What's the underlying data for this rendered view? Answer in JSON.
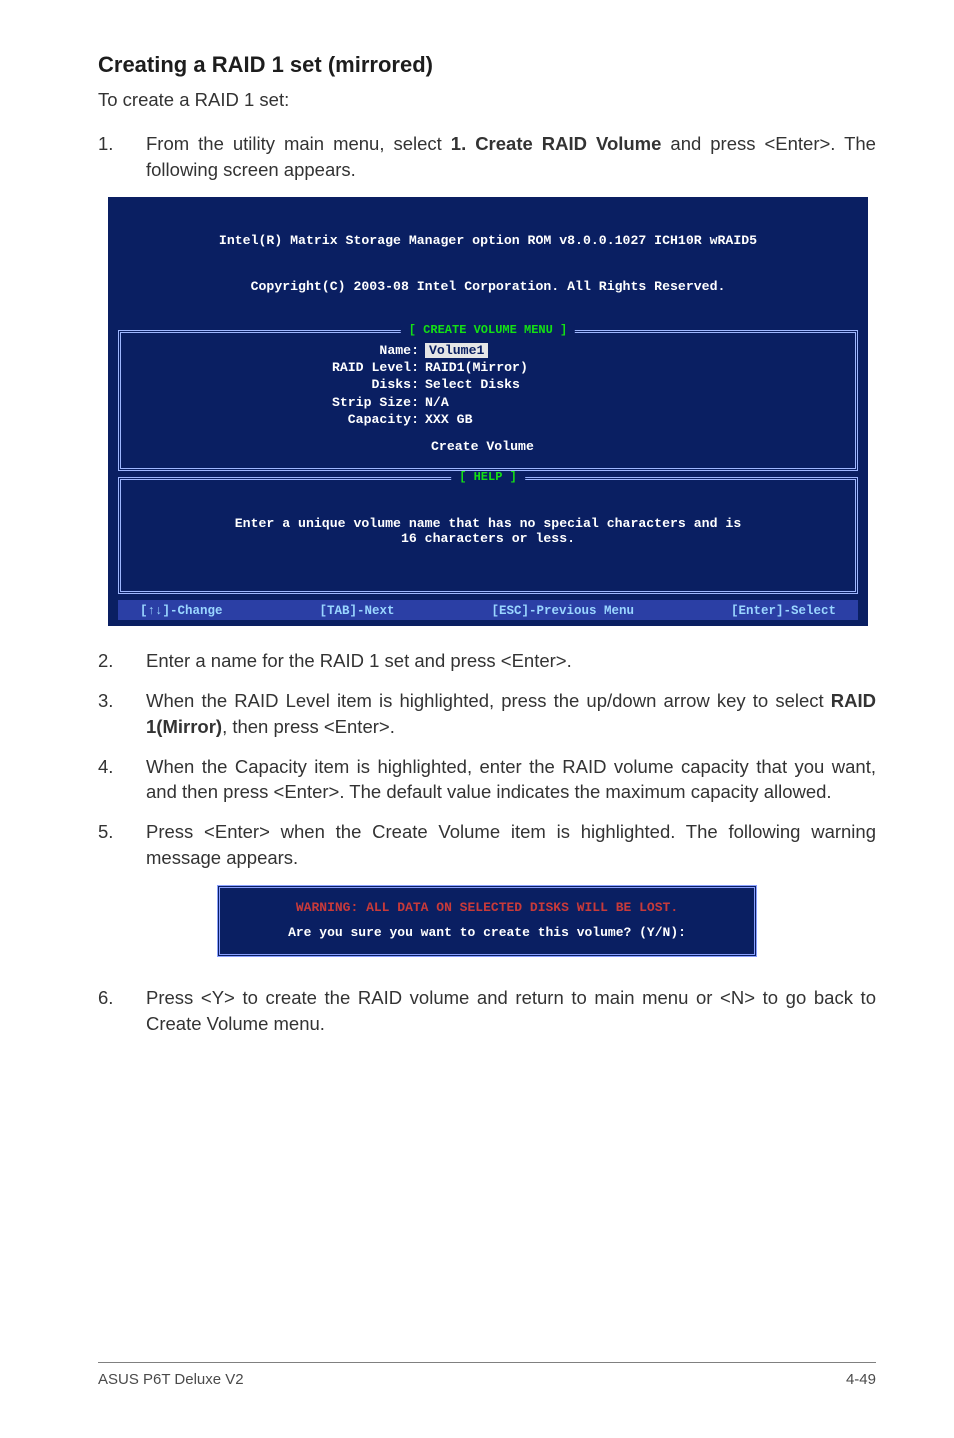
{
  "heading": "Creating a RAID 1 set (mirrored)",
  "intro": "To create a RAID 1 set:",
  "step1": {
    "num": "1.",
    "a": "From the utility main menu, select ",
    "b": "1. Create RAID Volume",
    "c": " and press <Enter>. The following screen appears."
  },
  "bios": {
    "header1": "Intel(R) Matrix Storage Manager option ROM v8.0.0.1027 ICH10R wRAID5",
    "header2": "Copyright(C) 2003-08 Intel Corporation. All Rights Reserved.",
    "create_menu_label": "[ CREATE VOLUME MENU ]",
    "rows": [
      {
        "label": "Name:",
        "value": "Volume1",
        "highlight": true
      },
      {
        "label": "RAID Level:",
        "value": "RAID1(Mirror)"
      },
      {
        "label": "Disks:",
        "value": "Select Disks"
      },
      {
        "label": "Strip Size:",
        "value": "N/A"
      },
      {
        "label": "Capacity:",
        "value": "XXX   GB"
      }
    ],
    "create_volume": "Create Volume",
    "help_label": "[ HELP ]",
    "help_text1": "Enter a unique volume name that has no special characters and is",
    "help_text2": "16 characters or less.",
    "footer": {
      "a": "[↑↓]-Change",
      "b": "[TAB]-Next",
      "c": "[ESC]-Previous Menu",
      "d": "[Enter]-Select"
    }
  },
  "step2": {
    "num": "2.",
    "text": "Enter a name for the RAID 1 set and press <Enter>."
  },
  "step3": {
    "num": "3.",
    "a": "When the RAID Level item is highlighted, press the up/down arrow key to select ",
    "b": "RAID 1(Mirror)",
    "c": ", then press <Enter>."
  },
  "step4": {
    "num": "4.",
    "text": "When the Capacity item is highlighted, enter the RAID volume capacity that you want, and then press <Enter>. The default value indicates the maximum capacity allowed."
  },
  "step5": {
    "num": "5.",
    "text": "Press <Enter> when the Create Volume item is highlighted. The following warning message appears."
  },
  "warn": {
    "line1": "WARNING: ALL DATA ON SELECTED DISKS WILL BE LOST.",
    "line2": "Are you sure you want to create this volume? (Y/N):"
  },
  "step6": {
    "num": "6.",
    "text": "Press <Y> to create the RAID volume and return to main menu or <N> to go back to Create Volume menu."
  },
  "footer_left": "ASUS P6T Deluxe V2",
  "footer_right": "4-49"
}
